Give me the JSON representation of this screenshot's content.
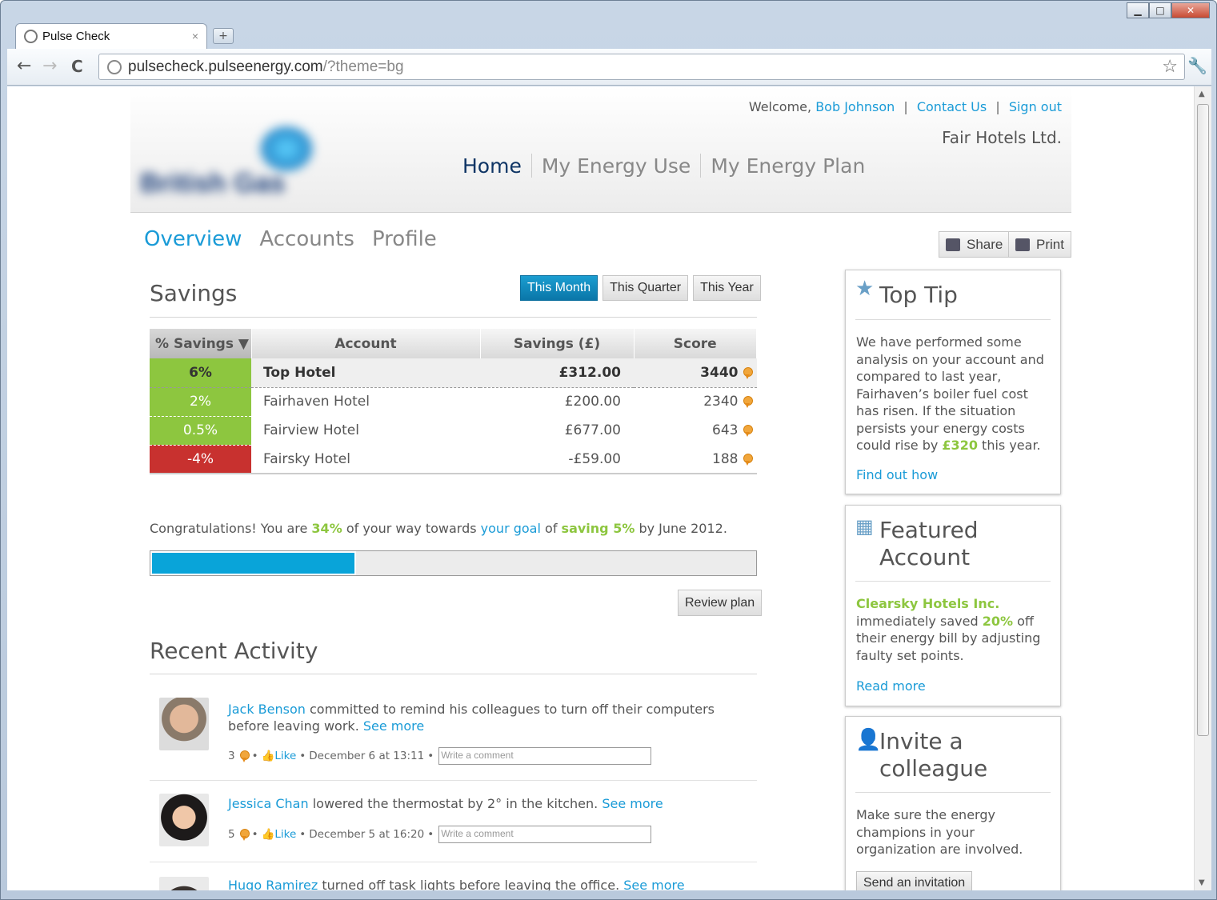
{
  "browser": {
    "tab_title": "Pulse Check",
    "tab_close": "×",
    "new_tab": "+",
    "url_host": "pulsecheck.pulseenergy.com",
    "url_rest": "/?theme=bg",
    "back": "←",
    "forward": "→",
    "reload": "C",
    "bookmark_icon": "☆",
    "wrench_icon": "🔧",
    "window_controls": {
      "minimize": "▁",
      "maximize": "□",
      "close": "✕"
    }
  },
  "header": {
    "welcome": "Welcome,",
    "user_name": "Bob Johnson",
    "contact": "Contact Us",
    "signout": "Sign out",
    "separator": "|",
    "company": "Fair Hotels Ltd.",
    "logo_text": "British Gas",
    "nav": [
      {
        "label": "Home",
        "active": true
      },
      {
        "label": "My Energy Use",
        "active": false
      },
      {
        "label": "My Energy Plan",
        "active": false
      }
    ]
  },
  "subnav": [
    {
      "label": "Overview",
      "active": true
    },
    {
      "label": "Accounts",
      "active": false
    },
    {
      "label": "Profile",
      "active": false
    }
  ],
  "actions": {
    "share": "Share",
    "print": "Print"
  },
  "savings": {
    "title": "Savings",
    "periods": [
      {
        "label": "This Month",
        "active": true
      },
      {
        "label": "This Quarter",
        "active": false
      },
      {
        "label": "This Year",
        "active": false
      }
    ],
    "columns": [
      "% Savings ▼",
      "Account",
      "Savings (£)",
      "Score"
    ],
    "rows": [
      {
        "pct": "6%",
        "account": "Top Hotel",
        "savings": "£312.00",
        "score": "3440",
        "status": "positive"
      },
      {
        "pct": "2%",
        "account": "Fairhaven Hotel",
        "savings": "£200.00",
        "score": "2340",
        "status": "positive"
      },
      {
        "pct": "0.5%",
        "account": "Fairview Hotel",
        "savings": "£677.00",
        "score": "643",
        "status": "positive"
      },
      {
        "pct": "-4%",
        "account": "Fairsky Hotel",
        "savings": "-£59.00",
        "score": "188",
        "status": "negative"
      }
    ],
    "colors": {
      "positive": "#8dc63f",
      "negative": "#c8312f",
      "accent": "#1a9bd7"
    }
  },
  "goal": {
    "t1": "Congratulations! You are",
    "progress_text": "34%",
    "t2": "of your way towards",
    "goal_link": "your goal",
    "t3": "of",
    "saving": "saving 5%",
    "t4": "by June 2012.",
    "progress": 0.34,
    "review_button": "Review plan"
  },
  "activity": {
    "title": "Recent Activity",
    "items": [
      {
        "name": "Jack Benson",
        "text": "committed to remind his colleagues to turn off their computers before leaving work.",
        "see_more": "See more",
        "score": "3",
        "like": "Like",
        "date": "December 6 at 13:11",
        "bullet": "•",
        "comment_placeholder": "Write a comment"
      },
      {
        "name": "Jessica Chan",
        "text": "lowered the thermostat by 2° in the kitchen.",
        "see_more": "See more",
        "score": "5",
        "like": "Like",
        "date": "December 5 at 16:20",
        "bullet": "•",
        "comment_placeholder": "Write a comment"
      },
      {
        "name": "Hugo Ramirez",
        "text": "turned off task lights before leaving the office.",
        "see_more": "See more"
      }
    ]
  },
  "sidebar": {
    "top_tip": {
      "icon": "star-icon",
      "title": "Top Tip",
      "body_before": "We have performed some analysis on your account and compared to last year, Fairhaven’s boiler fuel cost has risen. If the situation persists your energy costs could rise by",
      "amount": "£320",
      "body_after": "this year.",
      "link": "Find out how"
    },
    "featured": {
      "icon": "building-icon",
      "title": "Featured Account",
      "company": "Clearsky Hotels Inc.",
      "body_before": "immediately saved",
      "percent": "20%",
      "body_after": "off their energy bill by adjusting faulty set points.",
      "link": "Read more"
    },
    "invite": {
      "icon": "add-user-icon",
      "title": "Invite a colleague",
      "body": "Make sure the energy champions in your organization are involved.",
      "button": "Send an invitation"
    }
  }
}
